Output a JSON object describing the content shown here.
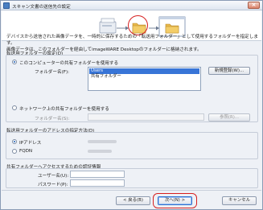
{
  "window": {
    "title": "スキャン文書の送信先の設定",
    "close_label": "×"
  },
  "description": {
    "line1": "デバイスから送信された画像データを、一時的に保存するための「転送用フォルダー」として使用するフォルダーを指定します。",
    "line2": "画像データは、このフォルダーを経由してimageWARE Desktopのフォルダーに格納されます。"
  },
  "transfer_folder_group": {
    "title": "転送用フォルダーの設定(D)",
    "local_radio_label": "このコンピューターの共有フォルダーを使用する",
    "local_selected": true,
    "folder_name_label": "フォルダー名(F):",
    "folders": [
      {
        "name": "Users",
        "selected": true
      },
      {
        "name": "共有フォルダー",
        "selected": false
      }
    ],
    "new_share_button": "新規登録(W)...",
    "network_radio_label": "ネットワーク上の共有フォルダーを使用する",
    "network_folder_label": "フォルダー名(S):",
    "browse_button": "参照(R)..."
  },
  "address_group": {
    "title": "転送用フォルダーのアドレスの指定方法(D)",
    "options": [
      {
        "label": "IPアドレス",
        "selected": true
      },
      {
        "label": "FQDN",
        "selected": false
      }
    ]
  },
  "auth_group": {
    "title": "共有フォルダーへアクセスするための認証情報",
    "username_label": "ユーザー名(U):",
    "password_label": "パスワード(P):"
  },
  "footer": {
    "back_button": "< 戻る(B)",
    "next_button": "次へ(N) >",
    "cancel_button": "キャンセル"
  },
  "colors": {
    "highlight_ring": "#d62020",
    "selection": "#3875d7",
    "folder": "#e8b84a"
  }
}
